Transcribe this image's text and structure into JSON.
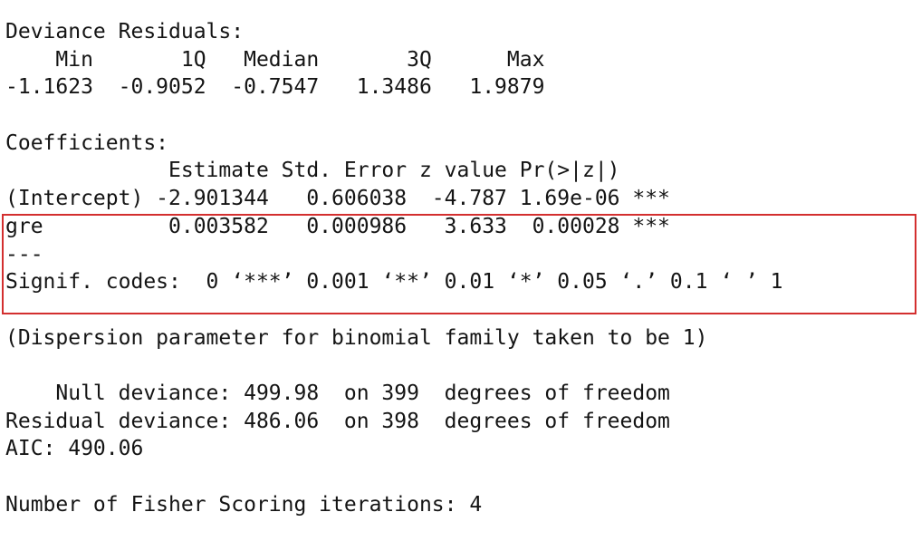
{
  "highlight": {
    "border_color": "#d32f2f"
  },
  "console": {
    "lines": [
      "Deviance Residuals: ",
      "    Min       1Q   Median       3Q      Max  ",
      "-1.1623  -0.9052  -0.7547   1.3486   1.9879  ",
      "",
      "Coefficients:",
      "             Estimate Std. Error z value Pr(>|z|)    ",
      "(Intercept) -2.901344   0.606038  -4.787 1.69e-06 ***",
      "gre          0.003582   0.000986   3.633  0.00028 ***",
      "---",
      "Signif. codes:  0 ‘***’ 0.001 ‘**’ 0.01 ‘*’ 0.05 ‘.’ 0.1 ‘ ’ 1",
      "",
      "(Dispersion parameter for binomial family taken to be 1)",
      "",
      "    Null deviance: 499.98  on 399  degrees of freedom",
      "Residual deviance: 486.06  on 398  degrees of freedom",
      "AIC: 490.06",
      "",
      "Number of Fisher Scoring iterations: 4"
    ]
  }
}
